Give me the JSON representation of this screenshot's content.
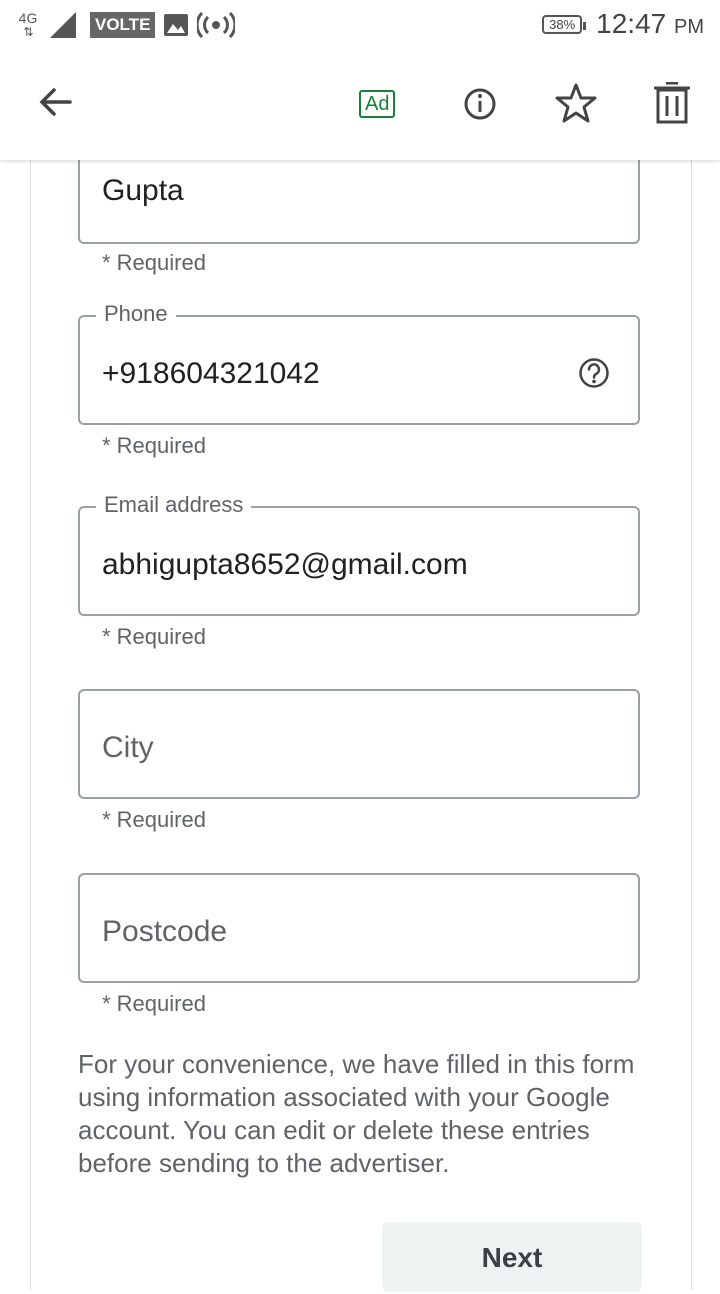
{
  "status_bar": {
    "network": "4G",
    "volte": "VOLTE",
    "battery": "38%",
    "time": "12:47",
    "ampm": "PM"
  },
  "app_bar": {
    "ad_badge": "Ad"
  },
  "form": {
    "last_name": {
      "value": "Gupta",
      "required": "* Required"
    },
    "phone": {
      "label": "Phone",
      "value": "+918604321042",
      "required": "* Required"
    },
    "email": {
      "label": "Email address",
      "value": "abhigupta8652@gmail.com",
      "required": "* Required"
    },
    "city": {
      "placeholder": "City",
      "required": "* Required"
    },
    "postcode": {
      "placeholder": "Postcode",
      "required": "* Required"
    },
    "helper_text": "For your convenience, we have filled in this form using information associated with your Google account. You can edit or delete these entries before sending to the advertiser.",
    "next_label": "Next"
  },
  "colors": {
    "ad_green": "#188038",
    "field_border": "#9aa0a6",
    "secondary_text": "#5f6368"
  }
}
